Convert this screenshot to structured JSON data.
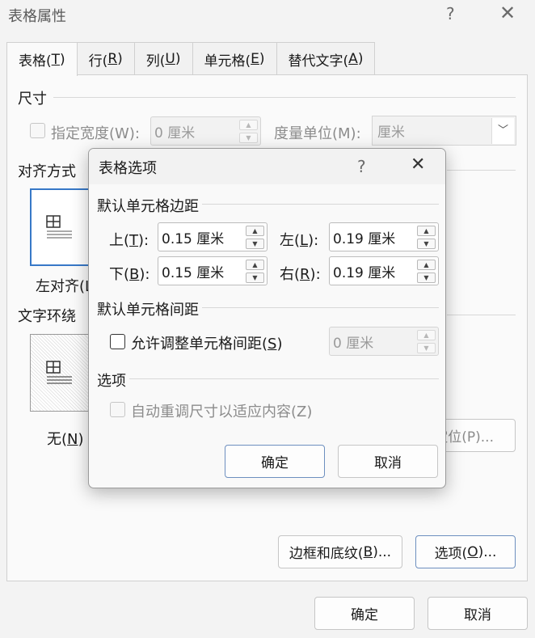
{
  "window": {
    "title": "表格属性",
    "help": "?",
    "close": "✕"
  },
  "tabs": [
    {
      "pre": "表格(",
      "key": "T",
      "post": ")"
    },
    {
      "pre": "行(",
      "key": "R",
      "post": ")"
    },
    {
      "pre": "列(",
      "key": "U",
      "post": ")"
    },
    {
      "pre": "单元格(",
      "key": "E",
      "post": ")"
    },
    {
      "pre": "替代文字(",
      "key": "A",
      "post": ")"
    }
  ],
  "size": {
    "heading": "尺寸",
    "width_label": "指定宽度(W):",
    "width_value": "0 厘米",
    "unit_label": "度量单位(M):",
    "unit_value": "厘米"
  },
  "alignment": {
    "heading": "对齐方式",
    "left_label": "左对齐(L"
  },
  "wrap": {
    "heading": "文字环绕",
    "none_label": {
      "pre": "无(",
      "key": "N",
      "post": ")"
    }
  },
  "positioning_fragment": "定位(P)...",
  "buttons": {
    "borders": {
      "pre": "边框和底纹(",
      "key": "B",
      "post": ")..."
    },
    "options": {
      "pre": "选项(",
      "key": "O",
      "post": ")..."
    },
    "ok": "确定",
    "cancel": "取消"
  },
  "modal": {
    "title": "表格选项",
    "help": "?",
    "close": "✕",
    "margins": {
      "heading": "默认单元格边距",
      "top": {
        "pre": "上(",
        "key": "T",
        "post": "):",
        "value": "0.15 厘米"
      },
      "bottom": {
        "pre": "下(",
        "key": "B",
        "post": "):",
        "value": "0.15 厘米"
      },
      "left": {
        "pre": "左(",
        "key": "L",
        "post": "):",
        "value": "0.19 厘米"
      },
      "right": {
        "pre": "右(",
        "key": "R",
        "post": "):",
        "value": "0.19 厘米"
      }
    },
    "spacing": {
      "heading": "默认单元格间距",
      "allow": {
        "pre": "允许调整单元格间距(",
        "key": "S",
        "post": ")"
      },
      "value": "0 厘米"
    },
    "options": {
      "heading": "选项",
      "autofit": "自动重调尺寸以适应内容(Z)"
    },
    "ok": "确定",
    "cancel": "取消"
  }
}
